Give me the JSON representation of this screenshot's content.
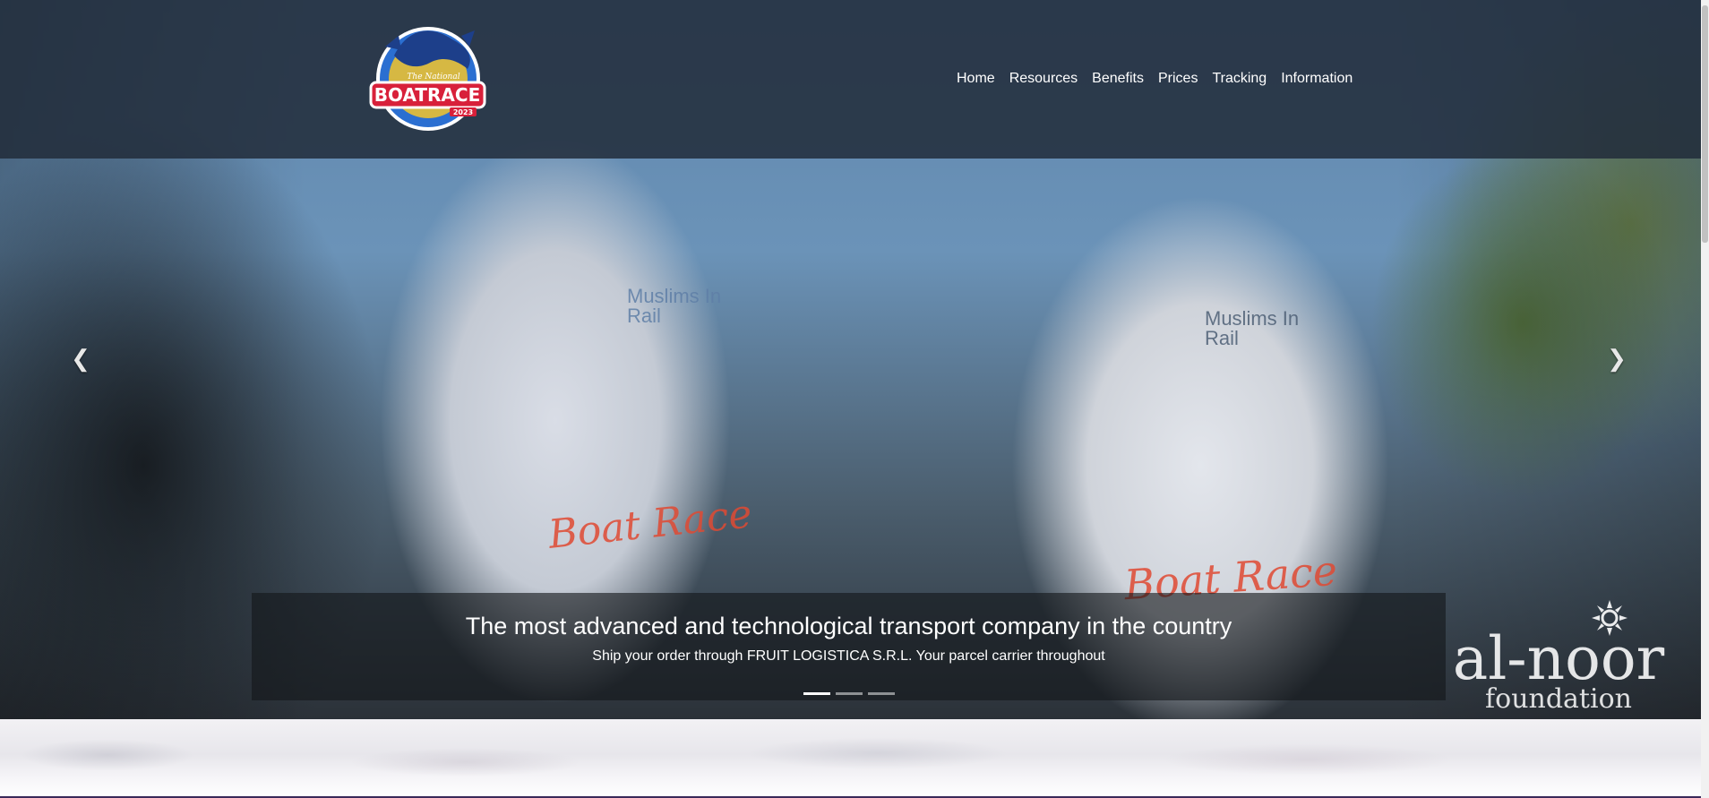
{
  "header": {
    "logo": {
      "icon": "dragon-boat-race-logo-icon",
      "text_main": "BOATRACE",
      "text_top": "The National",
      "text_year": "2023"
    },
    "nav": [
      {
        "label": "Home"
      },
      {
        "label": "Resources"
      },
      {
        "label": "Benefits"
      },
      {
        "label": "Prices"
      },
      {
        "label": "Tracking"
      },
      {
        "label": "Information"
      }
    ]
  },
  "carousel": {
    "prev_icon": "chevron-left-icon",
    "next_icon": "chevron-right-icon",
    "prev_glyph": "❮",
    "next_glyph": "❯",
    "caption_title": "The most advanced and technological transport company in the country",
    "caption_text": "Ship your order through FRUIT LOGISTICA S.R.L. Your parcel carrier throughout",
    "slides": 3,
    "active_slide": 1
  },
  "photo_text": {
    "shirt_brand": "Muslims In Rail",
    "shirt_print": "Boat Race"
  },
  "sponsor": {
    "line1": "al-noor",
    "line2": "foundation"
  },
  "colors": {
    "header_bg": "#222c3a",
    "caption_bg": "#14161a",
    "accent_red": "#e04a33",
    "logo_blue": "#1e63c8",
    "logo_red": "#d8203a",
    "logo_yellow": "#f5c52a"
  }
}
